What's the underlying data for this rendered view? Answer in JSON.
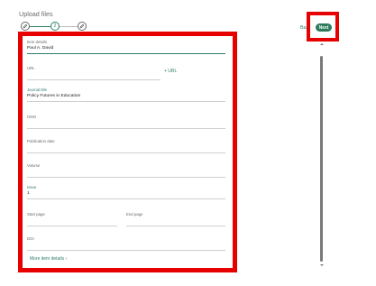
{
  "page": {
    "title": "Upload files"
  },
  "stepper": {
    "steps": [
      {
        "label": ""
      },
      {
        "label": "2"
      },
      {
        "label": ""
      }
    ]
  },
  "toolbar": {
    "back_label": "Ba",
    "next_label": "Next"
  },
  "form": {
    "item_details": {
      "label": "Item details",
      "value": "Paul A. David"
    },
    "url": {
      "label": "URL",
      "value": "",
      "add_label": "+ URL"
    },
    "journal_title": {
      "label": "Journal title",
      "value": "Policy Futures in Education"
    },
    "issn": {
      "label": "ISSN",
      "value": ""
    },
    "publication_date": {
      "label": "Publication date",
      "value": ""
    },
    "volume": {
      "label": "Volume",
      "value": ""
    },
    "issue": {
      "label": "Issue",
      "value": "1"
    },
    "start_page": {
      "label": "Start page",
      "value": ""
    },
    "end_page": {
      "label": "End page",
      "value": ""
    },
    "doi": {
      "label": "DOI",
      "value": ""
    },
    "more_label": "More item details  ›"
  },
  "colors": {
    "accent": "#2e7d6b",
    "next_bg": "#2b7a5c",
    "highlight": "#e60000"
  }
}
